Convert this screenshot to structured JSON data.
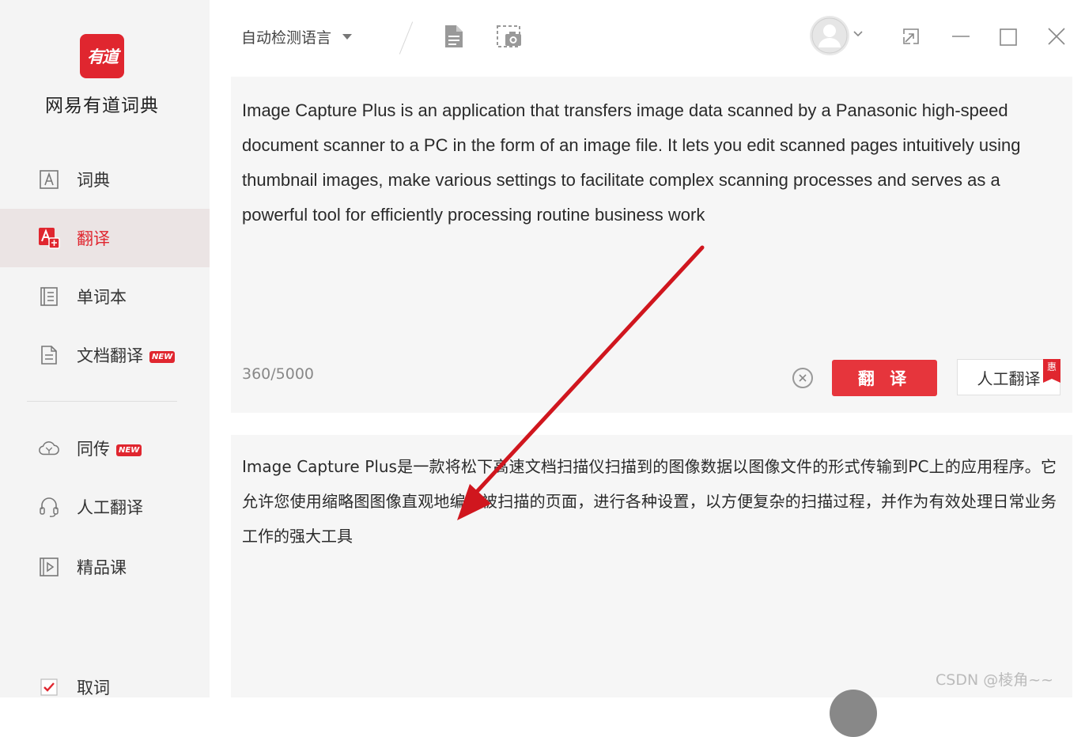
{
  "app": {
    "logo_text": "有道",
    "name": "网易有道词典"
  },
  "sidebar": {
    "items": [
      {
        "label": "词典"
      },
      {
        "label": "翻译"
      },
      {
        "label": "单词本"
      },
      {
        "label": "文档翻译",
        "badge": "NEW"
      },
      {
        "label": "同传",
        "badge": "NEW"
      },
      {
        "label": "人工翻译"
      },
      {
        "label": "精品课"
      },
      {
        "label": "取词"
      }
    ],
    "active_index": 1
  },
  "toolbar": {
    "language_select": "自动检测语言"
  },
  "source": {
    "text": "Image Capture Plus is an application that transfers image data scanned by a Panasonic high-speed document scanner to a PC in the form of an image file. It lets you edit scanned pages intuitively using thumbnail images, make various settings to facilitate complex scanning processes and serves as a powerful tool for efficiently processing routine business work",
    "char_count": "360/5000",
    "translate_label": "翻 译",
    "human_translate_label": "人工翻译",
    "discount_badge": "惠"
  },
  "result": {
    "text": "Image Capture Plus是一款将松下高速文档扫描仪扫描到的图像数据以图像文件的形式传输到PC上的应用程序。它允许您使用缩略图图像直观地编辑被扫描的页面，进行各种设置，以方便复杂的扫描过程，并作为有效处理日常业务工作的强大工具"
  },
  "watermark": "CSDN @棱角~~",
  "colors": {
    "brand_red": "#e0262f",
    "annotation_arrow": "#d0161e"
  }
}
